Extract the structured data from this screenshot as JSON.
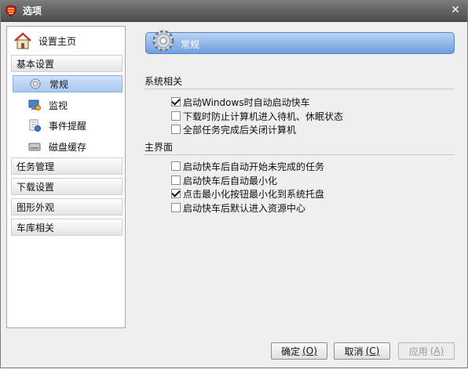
{
  "window": {
    "title": "选项"
  },
  "sidebar": {
    "home_label": "设置主页",
    "categories": [
      {
        "label": "基本设置"
      },
      {
        "label": "任务管理"
      },
      {
        "label": "下载设置"
      },
      {
        "label": "图形外观"
      },
      {
        "label": "车库相关"
      }
    ],
    "sub_items": [
      {
        "label": "常规",
        "icon": "gear-icon",
        "active": true
      },
      {
        "label": "监视",
        "icon": "monitor-icon",
        "active": false
      },
      {
        "label": "事件提醒",
        "icon": "reminder-icon",
        "active": false
      },
      {
        "label": "磁盘缓存",
        "icon": "disk-icon",
        "active": false
      }
    ]
  },
  "main": {
    "header_title": "常规",
    "sections": [
      {
        "title": "系统相关",
        "options": [
          {
            "label": "启动Windows时自动启动快车",
            "checked": true
          },
          {
            "label": "下载时防止计算机进入待机、休眠状态",
            "checked": false
          },
          {
            "label": "全部任务完成后关闭计算机",
            "checked": false
          }
        ]
      },
      {
        "title": "主界面",
        "options": [
          {
            "label": "启动快车后自动开始未完成的任务",
            "checked": false
          },
          {
            "label": "启动快车后自动最小化",
            "checked": false
          },
          {
            "label": "点击最小化按钮最小化到系统托盘",
            "checked": true
          },
          {
            "label": "启动快车后默认进入资源中心",
            "checked": false
          }
        ]
      }
    ]
  },
  "footer": {
    "ok": {
      "label": "确定",
      "key": "(O)"
    },
    "cancel": {
      "label": "取消",
      "key": "(C)"
    },
    "apply": {
      "label": "应用",
      "key": "(A)"
    }
  },
  "colors": {
    "header_top": "#bad3f2",
    "header_bottom": "#6f9fdc",
    "titlebar": "#4d4d4d"
  }
}
